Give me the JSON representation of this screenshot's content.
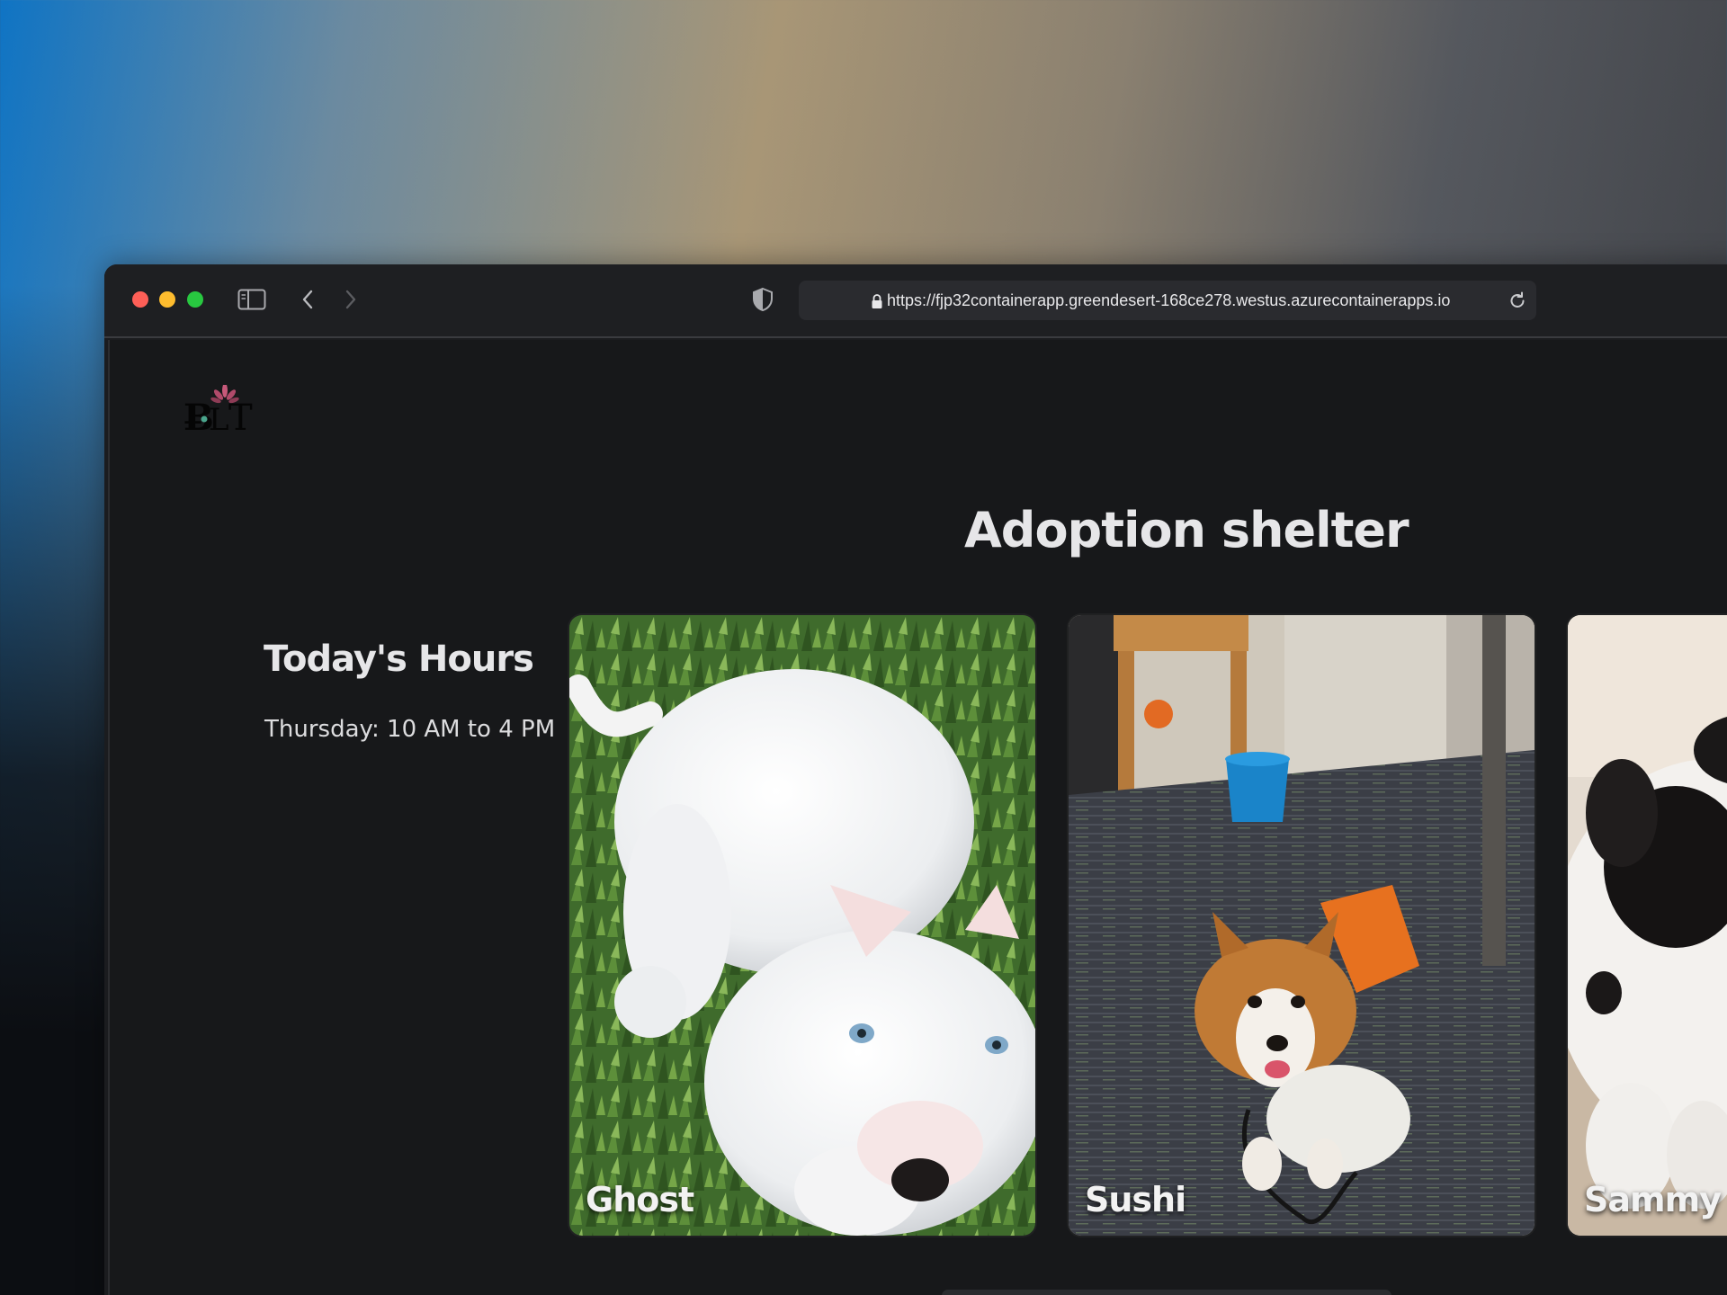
{
  "browser": {
    "url": "https://fjp32containerapp.greendesert-168ce278.westus.azurecontainerapps.io",
    "icons": {
      "sidebar": "sidebar-icon",
      "back": "chevron-left-icon",
      "forward": "chevron-right-icon",
      "privacy": "shield-icon",
      "lock": "lock-icon",
      "reload": "reload-icon"
    }
  },
  "page": {
    "title": "Adoption shelter",
    "hours": {
      "heading": "Today's Hours",
      "text": "Thursday: 10 AM to 4 PM"
    },
    "pets": [
      {
        "name": "Ghost"
      },
      {
        "name": "Sushi"
      },
      {
        "name": "Sammy"
      }
    ]
  }
}
